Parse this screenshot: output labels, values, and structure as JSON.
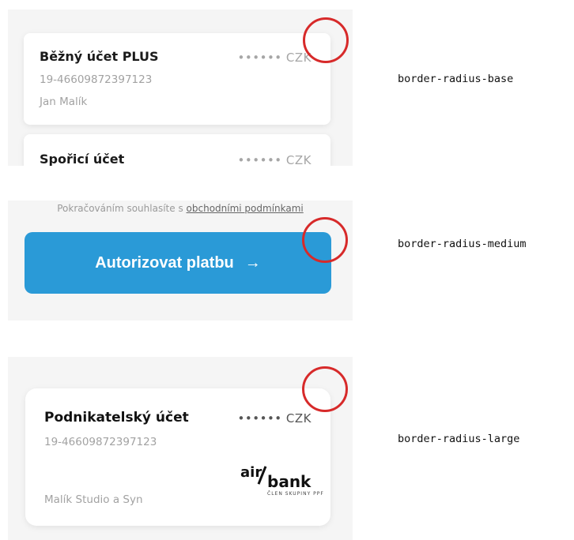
{
  "examples": {
    "base": {
      "accounts": [
        {
          "name": "Běžný účet PLUS",
          "balance_masked": "•••••• CZK",
          "number": "19-46609872397123",
          "owner": "Jan Malík"
        },
        {
          "name": "Spořicí účet",
          "balance_masked": "•••••• CZK"
        }
      ],
      "token_label": "border-radius-base"
    },
    "medium": {
      "consent_text": "Pokračováním souhlasíte s",
      "consent_link": "obchodními podmínkami",
      "cta_label": "Autorizovat platbu",
      "cta_arrow": "→",
      "token_label": "border-radius-medium"
    },
    "large": {
      "account": {
        "name": "Podnikatelský účet",
        "balance_masked": "•••••• CZK",
        "number": "19-46609872397123",
        "owner": "Malík Studio a Syn"
      },
      "logo": {
        "air": "air",
        "bank": "bank",
        "tagline": "ČLEN SKUPINY PPF"
      },
      "token_label": "border-radius-large"
    }
  },
  "colors": {
    "accent": "#2a9ad7",
    "highlight_ring": "#d72a2a",
    "panel_bg": "#f5f5f5"
  }
}
